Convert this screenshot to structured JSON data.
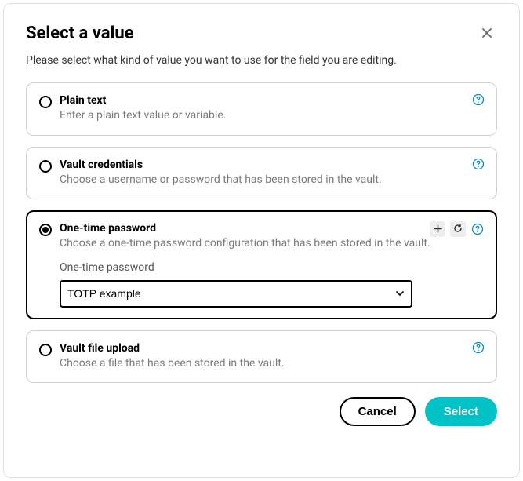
{
  "modal": {
    "title": "Select a value",
    "subtitle": "Please select what kind of value you want to use for the field you are editing."
  },
  "options": {
    "plain_text": {
      "title": "Plain text",
      "desc": "Enter a plain text value or variable."
    },
    "vault_credentials": {
      "title": "Vault credentials",
      "desc": "Choose a username or password that has been stored in the vault."
    },
    "otp": {
      "title": "One-time password",
      "desc": "Choose a one-time password configuration that has been stored in the vault.",
      "field_label": "One-time password",
      "selected_value": "TOTP example"
    },
    "vault_file": {
      "title": "Vault file upload",
      "desc": "Choose a file that has been stored in the vault."
    }
  },
  "footer": {
    "cancel": "Cancel",
    "select": "Select"
  }
}
